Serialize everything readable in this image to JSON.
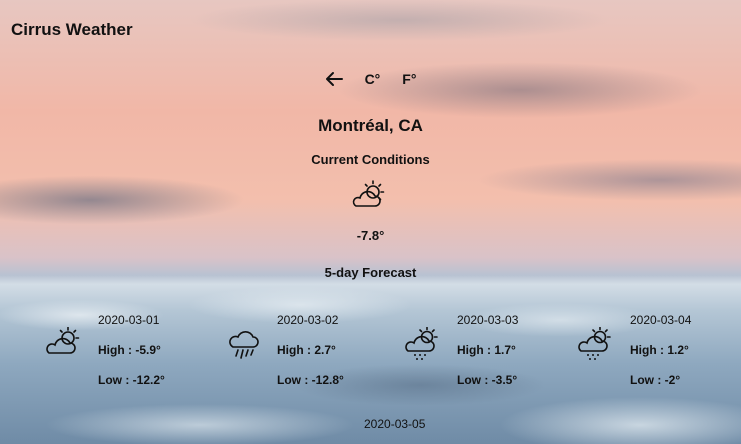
{
  "app": {
    "title": "Cirrus Weather"
  },
  "controls": {
    "back_icon": "arrow-left-icon",
    "celsius_label": "C°",
    "fahrenheit_label": "F°"
  },
  "location": {
    "city": "Montréal, CA"
  },
  "current": {
    "label": "Current Conditions",
    "icon": "partly-cloudy-sun-icon",
    "temperature": "-7.8°"
  },
  "forecast": {
    "label": "5-day Forecast",
    "days": [
      {
        "date": "2020-03-01",
        "icon": "partly-cloudy-sun-icon",
        "high_label": "High :",
        "high": "-5.9°",
        "low_label": "Low :",
        "low": "-12.2°"
      },
      {
        "date": "2020-03-02",
        "icon": "rain-cloud-icon",
        "high_label": "High :",
        "high": "2.7°",
        "low_label": "Low :",
        "low": "-12.8°"
      },
      {
        "date": "2020-03-03",
        "icon": "sun-cloud-rain-icon",
        "high_label": "High :",
        "high": "1.7°",
        "low_label": "Low :",
        "low": "-3.5°"
      },
      {
        "date": "2020-03-04",
        "icon": "sun-cloud-rain-icon",
        "high_label": "High :",
        "high": "1.2°",
        "low_label": "Low :",
        "low": "-2°"
      },
      {
        "date": "2020-03-05"
      }
    ]
  }
}
